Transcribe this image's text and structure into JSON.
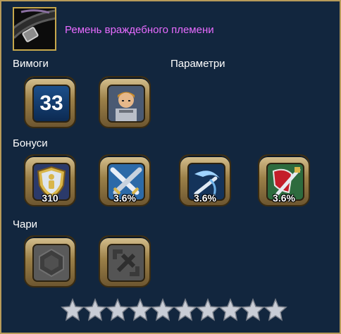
{
  "item": {
    "name": "Ремень враждебного племени",
    "icon": "dark-belt-icon",
    "name_color": "#e86bff"
  },
  "sections": {
    "requirements": "Вимоги",
    "parameters": "Параметри",
    "bonuses": "Бонуси",
    "enchants": "Чари"
  },
  "requirements": {
    "level": "33",
    "class_icon": "armored-knight-portrait-icon"
  },
  "bonuses": [
    {
      "icon": "shield-defense-icon",
      "value": "310"
    },
    {
      "icon": "crossed-swords-icon",
      "value": "3.6%"
    },
    {
      "icon": "swift-strike-icon",
      "value": "3.6%"
    },
    {
      "icon": "red-shield-sword-icon",
      "value": "3.6%"
    }
  ],
  "enchants": [
    {
      "icon": "empty-enchant-slot-round-icon"
    },
    {
      "icon": "empty-enchant-slot-rune-icon"
    }
  ],
  "rating": {
    "filled": 0,
    "total": 10,
    "star_color": "#c9cdd6"
  },
  "colors": {
    "frame_border": "#b79b5a",
    "background": "#12263e"
  }
}
